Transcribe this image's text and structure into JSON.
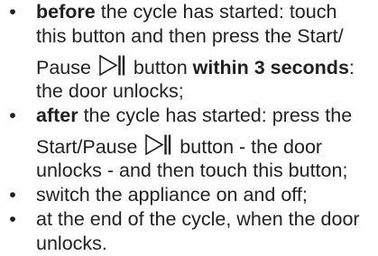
{
  "colors": {
    "text": "#231f20"
  },
  "icons": {
    "start_pause": "start-pause-icon",
    "bullet": "bullet-icon"
  },
  "bullets": {
    "symbol": "•"
  },
  "items": [
    {
      "bold_lead": "before",
      "text_1": " the cycle has started: touch",
      "text_2": "this button and then press the Start/",
      "text_3a": "Pause ",
      "text_3b": " button ",
      "bold_within": "within 3 seconds",
      "text_3c": ":",
      "text_4": "the door unlocks;"
    },
    {
      "bold_lead": "after",
      "text_1": " the cycle has started: press the",
      "text_2a": "Start/Pause ",
      "text_2b": " button - the door",
      "text_3": "unlocks - and then touch this button;"
    },
    {
      "text": "switch the appliance on and off;"
    },
    {
      "text_1": "at the end of the cycle, when the door",
      "text_2": "unlocks."
    }
  ]
}
